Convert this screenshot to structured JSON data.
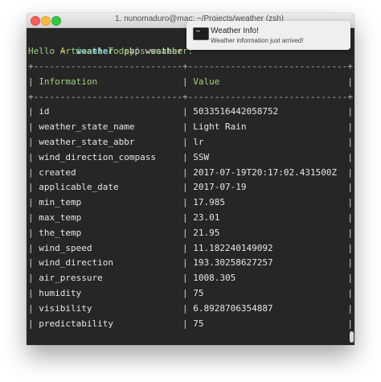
{
  "window": {
    "title": "1. nunomaduro@mac: ~/Projects/weather (zsh)"
  },
  "prompt": {
    "arrow": "➜",
    "cwd": "weather",
    "command": "php weather"
  },
  "output": {
    "greeting": "Hello Artisan! Today's weather:"
  },
  "table": {
    "border": "+----------------------------+------------------------------+",
    "headers": [
      "Information",
      "Value"
    ],
    "rows": [
      [
        "id",
        "5033516442058752"
      ],
      [
        "weather_state_name",
        "Light Rain"
      ],
      [
        "weather_state_abbr",
        "lr"
      ],
      [
        "wind_direction_compass",
        "SSW"
      ],
      [
        "created",
        "2017-07-19T20:17:02.431500Z"
      ],
      [
        "applicable_date",
        "2017-07-19"
      ],
      [
        "min_temp",
        "17.985"
      ],
      [
        "max_temp",
        "23.01"
      ],
      [
        "the_temp",
        "21.95"
      ],
      [
        "wind_speed",
        "11.182240149092"
      ],
      [
        "wind_direction",
        "193.30258627257"
      ],
      [
        "air_pressure",
        "1008.305"
      ],
      [
        "humidity",
        "75"
      ],
      [
        "visibility",
        "6.8928706354887"
      ],
      [
        "predictability",
        "75"
      ]
    ]
  },
  "notification": {
    "title": "Weather Info!",
    "body": "Weather information just arrived!",
    "icon": "terminal-icon"
  },
  "colors": {
    "terminal_bg": "#262626",
    "prompt_arrow": "#f0823c",
    "prompt_cwd": "#8ed3e6",
    "greeting": "#9fce7c",
    "header": "#9fce7c"
  }
}
